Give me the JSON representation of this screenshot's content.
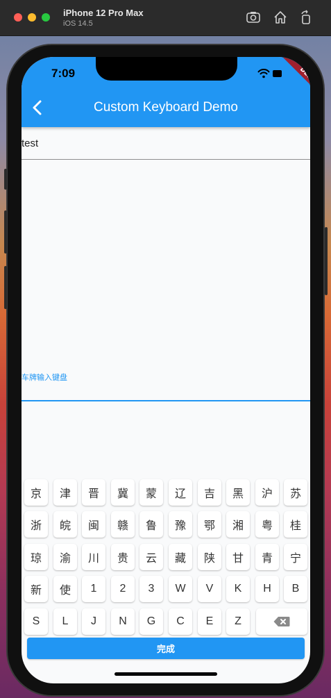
{
  "simulator": {
    "device_name": "iPhone 12 Pro Max",
    "os_version": "iOS 14.5",
    "icons": [
      "screenshot-icon",
      "home-icon",
      "rotate-icon"
    ]
  },
  "status_bar": {
    "time": "7:09",
    "icons": [
      "wifi-icon",
      "battery-icon"
    ]
  },
  "debug_banner": "DEBUG",
  "app_bar": {
    "title": "Custom Keyboard Demo",
    "back_icon": "chevron-left-icon",
    "color": "#2196f3"
  },
  "text_field": {
    "value": "test"
  },
  "plate_field": {
    "label": "车牌输入键盘",
    "value": ""
  },
  "keyboard": {
    "rows": [
      [
        "京",
        "津",
        "晋",
        "冀",
        "蒙",
        "辽",
        "吉",
        "黑",
        "沪",
        "苏"
      ],
      [
        "浙",
        "皖",
        "闽",
        "赣",
        "鲁",
        "豫",
        "鄂",
        "湘",
        "粤",
        "桂"
      ],
      [
        "琼",
        "渝",
        "川",
        "贵",
        "云",
        "藏",
        "陕",
        "甘",
        "青",
        "宁"
      ],
      [
        "新",
        "使",
        "1",
        "2",
        "3",
        "W",
        "V",
        "K",
        "H",
        "B"
      ],
      [
        "S",
        "L",
        "J",
        "N",
        "G",
        "C",
        "E",
        "Z"
      ]
    ],
    "delete_icon": "backspace-icon",
    "done_label": "完成"
  }
}
